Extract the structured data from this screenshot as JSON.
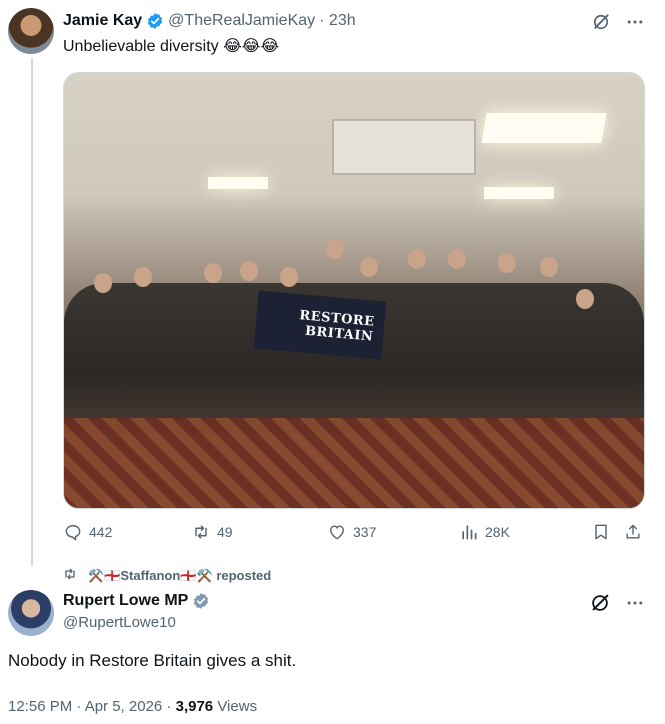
{
  "tweet": {
    "author_name": "Jamie Kay",
    "author_handle": "@TheRealJamieKay",
    "time": "· 23h",
    "text": "Unbelievable diversity 😂😂😂",
    "media": {
      "banner_line1": "RESTORE",
      "banner_line2": "BRITAIN"
    },
    "actions": {
      "replies": "442",
      "reposts": "49",
      "likes": "337",
      "views": "28K"
    }
  },
  "repost": {
    "reposter": "⚒️🏴󠁧󠁢󠁥󠁮󠁧󠁿Staffanon🏴󠁧󠁢󠁥󠁮󠁧󠁿⚒️",
    "label": "reposted"
  },
  "main_tweet": {
    "author_name": "Rupert Lowe MP",
    "author_handle": "@RupertLowe10",
    "text": "Nobody in Restore Britain gives a shit.",
    "time": "12:56 PM · Apr 5, 2026 ·",
    "views_count": "3,976",
    "views_label": "Views"
  },
  "colors": {
    "text": "#0f1419",
    "secondary": "#536471",
    "verified_blue": "#1d9bf0",
    "verified_grey": "#829aab",
    "border": "#cfd9de"
  },
  "icons": [
    "grok-icon",
    "more-icon",
    "verified-badge-icon",
    "reply-icon",
    "repost-icon",
    "like-icon",
    "views-icon",
    "bookmark-icon",
    "share-icon"
  ]
}
